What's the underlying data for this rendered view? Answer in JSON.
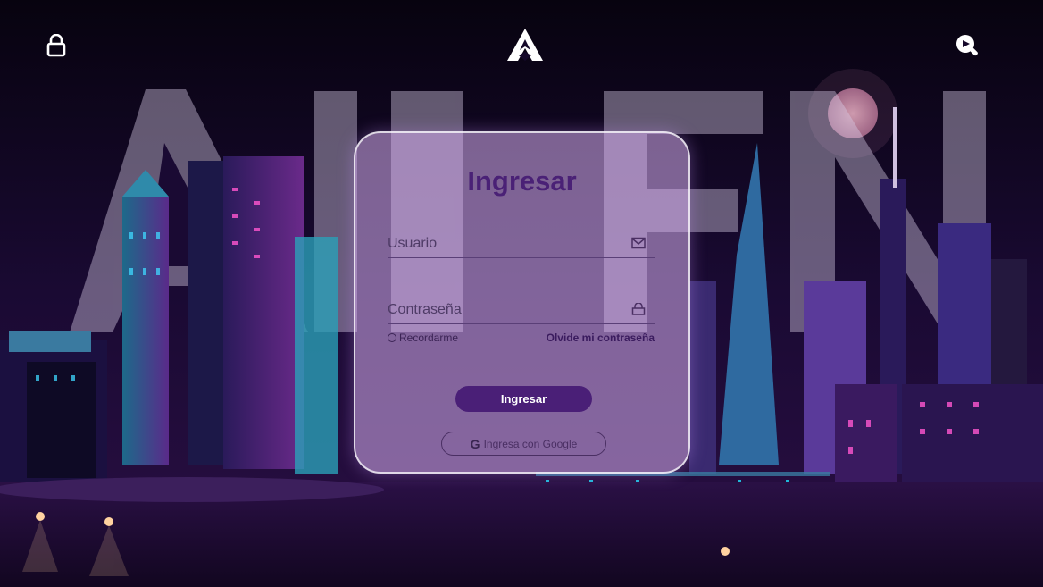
{
  "background": {
    "watermark_text": "AIDEN",
    "colors": {
      "sky": "#0b0518",
      "neon_pink": "#ff3fc8",
      "neon_cyan": "#3fd8ff",
      "neon_purple": "#8a4fff"
    }
  },
  "header": {
    "left_icon": "lock-icon",
    "logo_icon": "aiden-logo-icon",
    "right_icon": "search-icon"
  },
  "login": {
    "title": "Ingresar",
    "username": {
      "placeholder": "Usuario",
      "value": "",
      "icon": "mail-icon"
    },
    "password": {
      "placeholder": "Contraseña",
      "value": "",
      "icon": "lock-icon"
    },
    "remember_label": "Recordarme",
    "forgot_label": "Olvide mi contraseña",
    "submit_label": "Ingresar",
    "google_label": "Ingresa con Google",
    "colors": {
      "primary": "#4a1f77",
      "card": "#d7aff0"
    }
  }
}
